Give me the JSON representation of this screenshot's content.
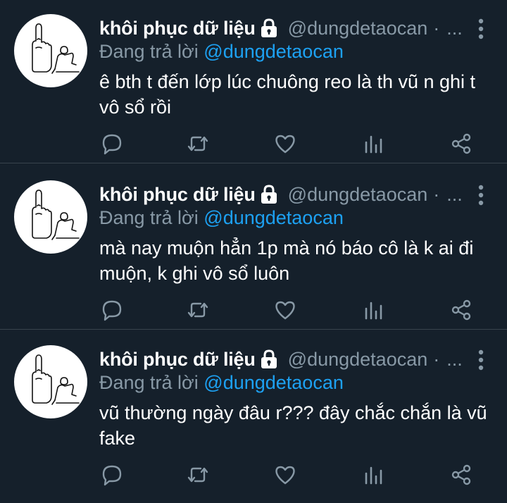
{
  "colors": {
    "background": "#15202b",
    "divider": "#38444d",
    "secondary_text": "#8899a6",
    "accent": "#1da1f2",
    "primary_text": "#ffffff"
  },
  "tweets": [
    {
      "author_name": "khôi phục dữ liệu",
      "handle": "@dungdetaocan",
      "separator": "·",
      "ellipsis": "...",
      "reply_prefix": "Đang trả lời",
      "reply_to": "@dungdetaocan",
      "text": "ê bth t đến lớp lúc chuông reo là th vũ n ghi t vô sổ rồi",
      "icons": [
        "lock-icon",
        "more-icon",
        "reply-icon",
        "retweet-icon",
        "like-icon",
        "stats-icon",
        "share-icon"
      ]
    },
    {
      "author_name": "khôi phục dữ liệu",
      "handle": "@dungdetaocan",
      "separator": "·",
      "ellipsis": "...",
      "reply_prefix": "Đang trả lời",
      "reply_to": "@dungdetaocan",
      "text": "mà nay muộn hẳn 1p mà nó báo cô là k ai đi muộn, k ghi vô sổ luôn",
      "icons": [
        "lock-icon",
        "more-icon",
        "reply-icon",
        "retweet-icon",
        "like-icon",
        "stats-icon",
        "share-icon"
      ]
    },
    {
      "author_name": "khôi phục dữ liệu",
      "handle": "@dungdetaocan",
      "separator": "·",
      "ellipsis": "...",
      "reply_prefix": "Đang trả lời",
      "reply_to": "@dungdetaocan",
      "text": "vũ thường ngày đâu r??? đây chắc chắn là vũ fake",
      "icons": [
        "lock-icon",
        "more-icon",
        "reply-icon",
        "retweet-icon",
        "like-icon",
        "stats-icon",
        "share-icon"
      ]
    }
  ]
}
